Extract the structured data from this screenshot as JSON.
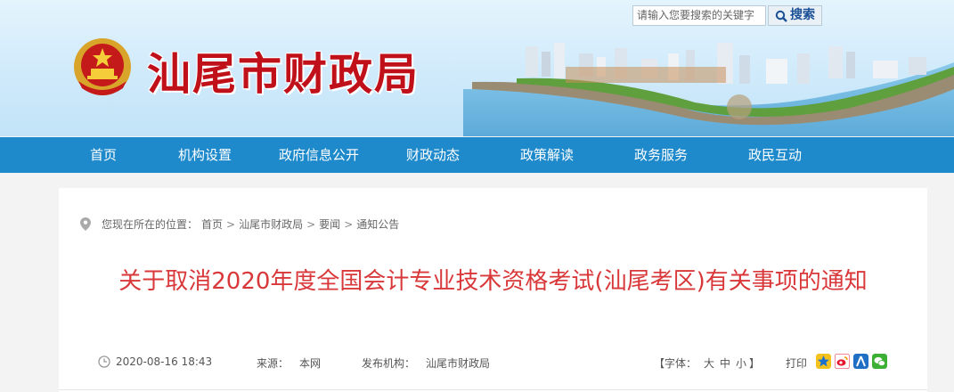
{
  "site": {
    "title": "汕尾市财政局"
  },
  "search": {
    "placeholder": "请输入您要搜索的关键字",
    "button_label": "搜索"
  },
  "nav": {
    "items": [
      "首页",
      "机构设置",
      "政府信息公开",
      "财政动态",
      "政策解读",
      "政务服务",
      "政民互动"
    ]
  },
  "breadcrumb": {
    "prefix": "您现在所在的位置：",
    "items": [
      "首页",
      "汕尾市财政局",
      "要闻",
      "通知公告"
    ],
    "separator": ">"
  },
  "article": {
    "title": "关于取消2020年度全国会计专业技术资格考试(汕尾考区)有关事项的通知",
    "date": "2020-08-16 18:43",
    "source_label": "来源：",
    "source": "本网",
    "publisher_label": "发布机构：",
    "publisher": "汕尾市财政局",
    "font_size_label": "【字体：",
    "font_large": "大",
    "font_medium": "中",
    "font_small": "小",
    "font_size_close": "】",
    "print_label": "打印"
  },
  "share_icons": [
    "qzone-icon",
    "weibo-icon",
    "renren-icon",
    "wechat-icon"
  ],
  "colors": {
    "nav_bg": "#1e8acb",
    "title_red": "#c0111a",
    "article_title": "#d9383a"
  }
}
